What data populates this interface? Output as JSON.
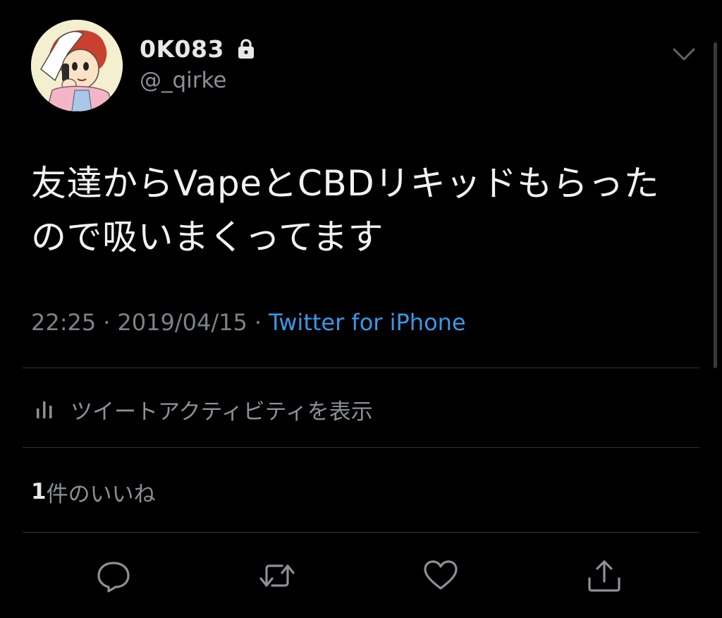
{
  "tweet": {
    "display_name": "0K083",
    "handle": "@_qirke",
    "text": "友達からVapeとCBDリキッドもらったので吸いまくってます",
    "time": "22:25",
    "date": "2019/04/15",
    "separator": "·",
    "source": "Twitter for iPhone"
  },
  "activity": {
    "label": "ツイートアクティビティを表示",
    "icon": "bar-chart-icon"
  },
  "likes": {
    "count": "1",
    "label": "件のいいね"
  },
  "actions": {
    "icons": [
      "reply-icon",
      "retweet-icon",
      "like-icon",
      "share-icon"
    ]
  },
  "colors": {
    "background": "#000000",
    "text_primary": "#f2f2f2",
    "text_secondary": "#8b9197",
    "link": "#3a98e6",
    "divider": "#2f3336"
  }
}
